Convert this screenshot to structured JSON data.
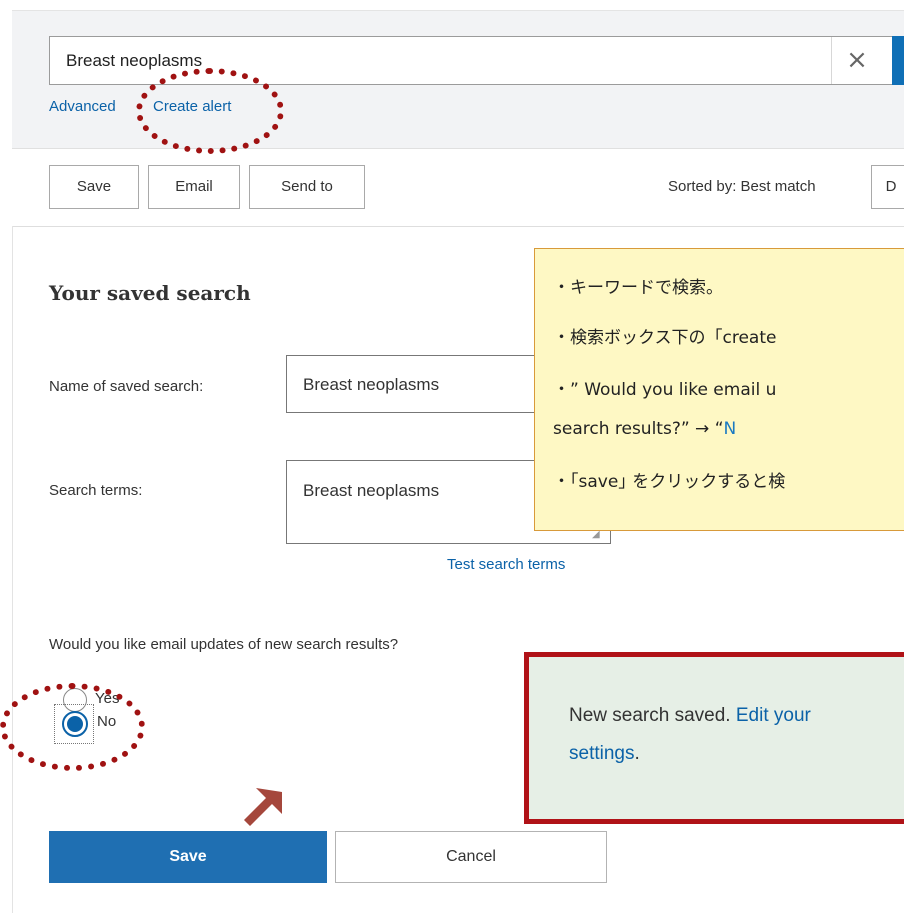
{
  "search": {
    "query": "Breast neoplasms",
    "clear_icon": "×",
    "advanced_label": "Advanced",
    "create_alert_label": "Create alert"
  },
  "toolbar": {
    "save_label": "Save",
    "email_label": "Email",
    "send_to_label": "Send to",
    "sorted_by": "Sorted by: Best match",
    "display_label": "D"
  },
  "saved_search": {
    "title": "Your saved search",
    "name_label": "Name of saved search:",
    "name_value": "Breast neoplasms",
    "terms_label": "Search terms:",
    "terms_value": "Breast neoplasms",
    "test_link": "Test search terms",
    "email_question": "Would you like email updates of new search results?",
    "options": [
      "Yes",
      "No"
    ],
    "selected_option": "No",
    "save_button": "Save",
    "cancel_button": "Cancel"
  },
  "note": {
    "line1": "・キーワードで検索。",
    "line2": "・検索ボックス下の「create",
    "line3": "・” Would you like email u",
    "line4a": "  search results?” →   “",
    "line4b": "N",
    "line5": "・｢save｣ をクリックすると検"
  },
  "confirmation": {
    "text": "New search saved. ",
    "link1": "Edit your",
    "link2": "settings",
    "suffix": "."
  },
  "colors": {
    "accent": "#1f6fb2",
    "marker": "#a01212",
    "note_bg": "#fef8c4",
    "confirm_bg": "#e6efe6"
  }
}
